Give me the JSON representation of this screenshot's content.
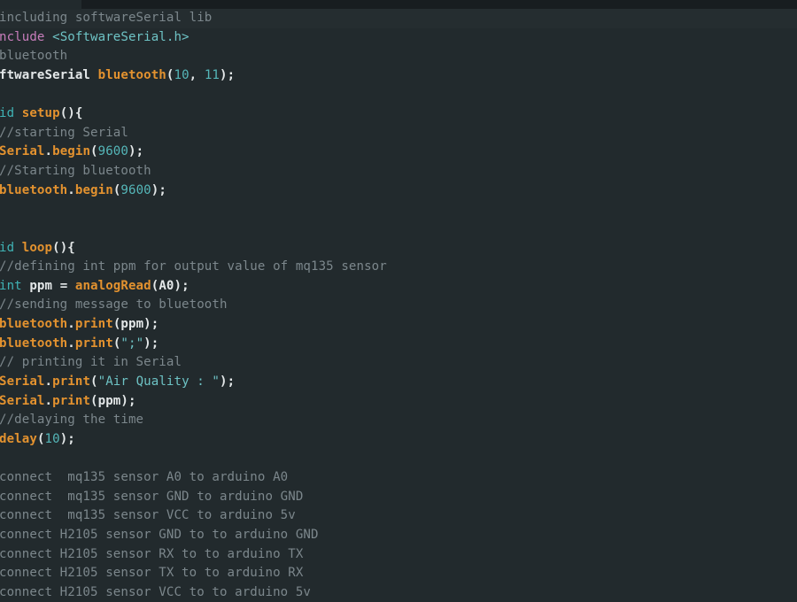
{
  "editor": {
    "lines": [
      [
        [
          "comment",
          "including softwareSerial lib"
        ]
      ],
      [
        [
          "keyword",
          "nclude"
        ],
        [
          "plain",
          " "
        ],
        [
          "string",
          "<SoftwareSerial.h>"
        ]
      ],
      [
        [
          "comment",
          "bluetooth"
        ]
      ],
      [
        [
          "bold",
          "ftwareSerial "
        ],
        [
          "func",
          "bluetooth"
        ],
        [
          "bold",
          "("
        ],
        [
          "number",
          "10"
        ],
        [
          "bold",
          ", "
        ],
        [
          "number",
          "11"
        ],
        [
          "bold",
          ");"
        ]
      ],
      [],
      [
        [
          "type",
          "id"
        ],
        [
          "plain",
          " "
        ],
        [
          "func",
          "setup"
        ],
        [
          "bold",
          "(){"
        ]
      ],
      [
        [
          "comment",
          "//starting Serial"
        ]
      ],
      [
        [
          "func",
          "Serial"
        ],
        [
          "bold",
          "."
        ],
        [
          "func",
          "begin"
        ],
        [
          "bold",
          "("
        ],
        [
          "number",
          "9600"
        ],
        [
          "bold",
          ");"
        ]
      ],
      [
        [
          "comment",
          "//Starting bluetooth"
        ]
      ],
      [
        [
          "func",
          "bluetooth"
        ],
        [
          "bold",
          "."
        ],
        [
          "func",
          "begin"
        ],
        [
          "bold",
          "("
        ],
        [
          "number",
          "9600"
        ],
        [
          "bold",
          ");"
        ]
      ],
      [],
      [],
      [
        [
          "type",
          "id"
        ],
        [
          "plain",
          " "
        ],
        [
          "func",
          "loop"
        ],
        [
          "bold",
          "(){"
        ]
      ],
      [
        [
          "comment",
          "//defining int ppm for output value of mq135 sensor"
        ]
      ],
      [
        [
          "type",
          "int"
        ],
        [
          "bold",
          " ppm = "
        ],
        [
          "func",
          "analogRead"
        ],
        [
          "bold",
          "(A0);"
        ]
      ],
      [
        [
          "comment",
          "//sending message to bluetooth"
        ]
      ],
      [
        [
          "func",
          "bluetooth"
        ],
        [
          "bold",
          "."
        ],
        [
          "func",
          "print"
        ],
        [
          "bold",
          "(ppm);"
        ]
      ],
      [
        [
          "func",
          "bluetooth"
        ],
        [
          "bold",
          "."
        ],
        [
          "func",
          "print"
        ],
        [
          "bold",
          "("
        ],
        [
          "string",
          "\";\""
        ],
        [
          "bold",
          ");"
        ]
      ],
      [
        [
          "comment",
          "// printing it in Serial"
        ]
      ],
      [
        [
          "func",
          "Serial"
        ],
        [
          "bold",
          "."
        ],
        [
          "func",
          "print"
        ],
        [
          "bold",
          "("
        ],
        [
          "string",
          "\"Air Quality : \""
        ],
        [
          "bold",
          ");"
        ]
      ],
      [
        [
          "func",
          "Serial"
        ],
        [
          "bold",
          "."
        ],
        [
          "func",
          "print"
        ],
        [
          "bold",
          "(ppm);"
        ]
      ],
      [
        [
          "comment",
          "//delaying the time"
        ]
      ],
      [
        [
          "func",
          "delay"
        ],
        [
          "bold",
          "("
        ],
        [
          "number",
          "10"
        ],
        [
          "bold",
          ");"
        ]
      ],
      [],
      [
        [
          "comment",
          "connect  mq135 sensor A0 to arduino A0"
        ]
      ],
      [
        [
          "comment",
          "connect  mq135 sensor GND to arduino GND"
        ]
      ],
      [
        [
          "comment",
          "connect  mq135 sensor VCC to arduino 5v"
        ]
      ],
      [
        [
          "comment",
          "connect H2105 sensor GND to to arduino GND"
        ]
      ],
      [
        [
          "comment",
          "connect H2105 sensor RX to to arduino TX"
        ]
      ],
      [
        [
          "comment",
          "connect H2105 sensor TX to to arduino RX"
        ]
      ],
      [
        [
          "comment",
          "connect H2105 sensor VCC to to arduino 5v"
        ]
      ]
    ]
  }
}
